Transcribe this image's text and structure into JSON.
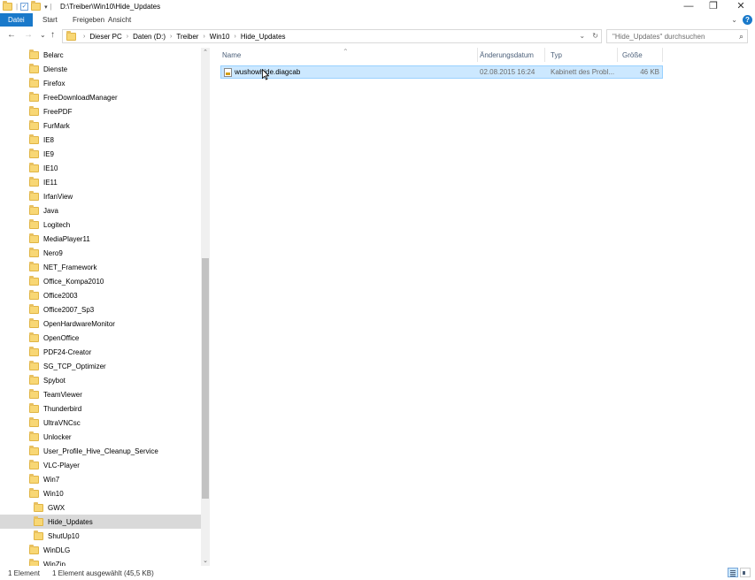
{
  "window": {
    "title": "D:\\Treiber\\Win10\\Hide_Updates",
    "minimize": "—",
    "restore": "❐",
    "close": "✕"
  },
  "ribbon": {
    "tabs": [
      "Datei",
      "Start",
      "Freigeben",
      "Ansicht"
    ],
    "collapse_chevron": "⌄",
    "help": "?"
  },
  "address": {
    "back": "←",
    "forward": "→",
    "recent": "⌄",
    "up": "↑",
    "crumbs": [
      "Dieser PC",
      "Daten (D:)",
      "Treiber",
      "Win10",
      "Hide_Updates"
    ],
    "dropdown": "⌄",
    "refresh": "↻"
  },
  "search": {
    "placeholder": "\"Hide_Updates\" durchsuchen",
    "icon": "⌕"
  },
  "tree": [
    {
      "label": "Belarc",
      "indent": 0
    },
    {
      "label": "Dienste",
      "indent": 0
    },
    {
      "label": "Firefox",
      "indent": 0
    },
    {
      "label": "FreeDownloadManager",
      "indent": 0
    },
    {
      "label": "FreePDF",
      "indent": 0
    },
    {
      "label": "FurMark",
      "indent": 0
    },
    {
      "label": "IE8",
      "indent": 0
    },
    {
      "label": "IE9",
      "indent": 0
    },
    {
      "label": "IE10",
      "indent": 0
    },
    {
      "label": "IE11",
      "indent": 0
    },
    {
      "label": "IrfanView",
      "indent": 0
    },
    {
      "label": "Java",
      "indent": 0
    },
    {
      "label": "Logitech",
      "indent": 0
    },
    {
      "label": "MediaPlayer11",
      "indent": 0
    },
    {
      "label": "Nero9",
      "indent": 0
    },
    {
      "label": "NET_Framework",
      "indent": 0
    },
    {
      "label": "Office_Kompa2010",
      "indent": 0
    },
    {
      "label": "Office2003",
      "indent": 0
    },
    {
      "label": "Office2007_Sp3",
      "indent": 0
    },
    {
      "label": "OpenHardwareMonitor",
      "indent": 0
    },
    {
      "label": "OpenOffice",
      "indent": 0
    },
    {
      "label": "PDF24-Creator",
      "indent": 0
    },
    {
      "label": "SG_TCP_Optimizer",
      "indent": 0
    },
    {
      "label": "Spybot",
      "indent": 0
    },
    {
      "label": "TeamViewer",
      "indent": 0
    },
    {
      "label": "Thunderbird",
      "indent": 0
    },
    {
      "label": "UltraVNCsc",
      "indent": 0
    },
    {
      "label": "Unlocker",
      "indent": 0
    },
    {
      "label": "User_Profile_Hive_Cleanup_Service",
      "indent": 0
    },
    {
      "label": "VLC-Player",
      "indent": 0
    },
    {
      "label": "Win7",
      "indent": 0
    },
    {
      "label": "Win10",
      "indent": 0
    },
    {
      "label": "GWX",
      "indent": 1
    },
    {
      "label": "Hide_Updates",
      "indent": 1,
      "selected": true
    },
    {
      "label": "ShutUp10",
      "indent": 1
    },
    {
      "label": "WinDLG",
      "indent": 0
    },
    {
      "label": "WinZip",
      "indent": 0
    }
  ],
  "columns": [
    "Name",
    "Änderungsdatum",
    "Typ",
    "Größe"
  ],
  "files": [
    {
      "name": "wushowhide.diagcab",
      "date": "02.08.2015 16:24",
      "type": "Kabinett des Probl...",
      "size": "46 KB"
    }
  ],
  "status": {
    "count": "1 Element",
    "selection": "1 Element ausgewählt (45,5 KB)"
  },
  "colors": {
    "accent": "#1979ca",
    "selection": "#cce8ff",
    "folder": "#f8d775"
  }
}
